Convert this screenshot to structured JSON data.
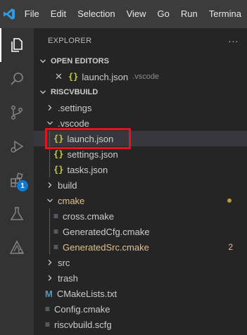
{
  "menubar": {
    "items": [
      "File",
      "Edit",
      "Selection",
      "View",
      "Go",
      "Run",
      "Termina"
    ]
  },
  "activitybar": {
    "icons": [
      "files-icon",
      "search-icon",
      "source-control-icon",
      "run-debug-icon",
      "extensions-icon",
      "testing-icon",
      "cmake-icon"
    ],
    "extensions_badge": "1"
  },
  "explorer": {
    "title": "EXPLORER",
    "more": "···",
    "open_editors": {
      "label": "OPEN EDITORS",
      "items": [
        {
          "name": "launch.json",
          "description": ".vscode"
        }
      ]
    },
    "workspace": {
      "label": "RISCVBUILD",
      "tree": [
        {
          "name": ".settings",
          "kind": "folder-collapsed",
          "indent": 1
        },
        {
          "name": ".vscode",
          "kind": "folder-expanded",
          "indent": 1
        },
        {
          "name": "launch.json",
          "kind": "json",
          "indent": 2,
          "selected": true
        },
        {
          "name": "settings.json",
          "kind": "json",
          "indent": 2
        },
        {
          "name": "tasks.json",
          "kind": "json",
          "indent": 2
        },
        {
          "name": "build",
          "kind": "folder-collapsed",
          "indent": 1
        },
        {
          "name": "cmake",
          "kind": "folder-expanded",
          "indent": 1,
          "modified": true,
          "dot": true
        },
        {
          "name": "cross.cmake",
          "kind": "cmake",
          "indent": 2
        },
        {
          "name": "GeneratedCfg.cmake",
          "kind": "cmake",
          "indent": 2
        },
        {
          "name": "GeneratedSrc.cmake",
          "kind": "cmake",
          "indent": 2,
          "modified": true,
          "count": "2"
        },
        {
          "name": "src",
          "kind": "folder-collapsed",
          "indent": 1
        },
        {
          "name": "trash",
          "kind": "folder-collapsed",
          "indent": 1
        },
        {
          "name": "CMakeLists.txt",
          "kind": "markdown",
          "indent": 1
        },
        {
          "name": "Config.cmake",
          "kind": "cmake",
          "indent": 1
        },
        {
          "name": "riscvbuild.scfg",
          "kind": "cmake",
          "indent": 1
        }
      ]
    }
  },
  "colors": {
    "menubar": "#3c3c3c",
    "activitybar": "#333333",
    "sidebar": "#252526",
    "modified": "#e2c08d",
    "json_icon": "#cbcb41",
    "highlight": "#e3141b",
    "badge": "#0e7ad3"
  }
}
